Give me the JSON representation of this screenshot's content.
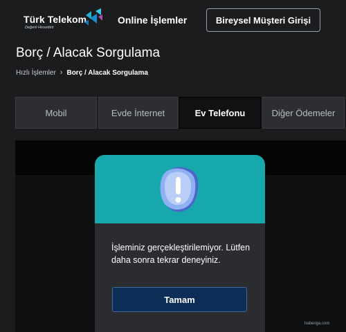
{
  "header": {
    "logo_text": "Türk Telekom",
    "logo_tagline": "Değerli Hissettirir",
    "nav_online": "Online İşlemler",
    "login_button": "Bireysel Müşteri Girişi"
  },
  "page": {
    "title": "Borç / Alacak Sorgulama",
    "breadcrumb": {
      "parent": "Hızlı İşlemler",
      "current": "Borç / Alacak Sorgulama"
    }
  },
  "tabs": [
    {
      "label": "Mobil"
    },
    {
      "label": "Evde İnternet"
    },
    {
      "label": "Ev Telefonu"
    },
    {
      "label": "Diğer Ödemeler"
    }
  ],
  "active_tab": "Ev Telefonu",
  "modal": {
    "message": "İşleminiz gerçekleştirilemiyor. Lütfen daha sonra tekrar deneyiniz.",
    "ok_button": "Tamam",
    "icon": "exclamation-icon",
    "accent_color": "#17a8ad"
  },
  "watermark": "haberiga.com"
}
